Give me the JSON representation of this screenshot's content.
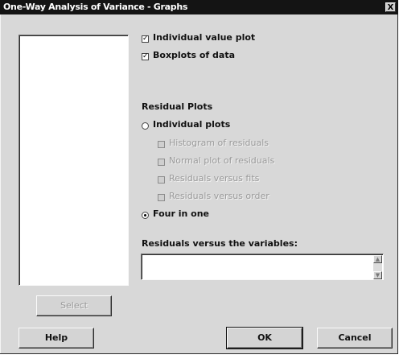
{
  "window": {
    "title": "One-Way Analysis of Variance - Graphs",
    "close_glyph": "X"
  },
  "graphs": {
    "individual_value_plot": {
      "label": "Individual value plot",
      "checked": true
    },
    "boxplots": {
      "label": "Boxplots of data",
      "checked": true
    }
  },
  "residual_plots": {
    "heading": "Residual Plots",
    "individual_plots": {
      "label": "Individual plots",
      "selected": false
    },
    "options": [
      {
        "label": "Histogram of residuals",
        "checked": false
      },
      {
        "label": "Normal plot of residuals",
        "checked": false
      },
      {
        "label": "Residuals versus fits",
        "checked": false
      },
      {
        "label": "Residuals versus order",
        "checked": false
      }
    ],
    "four_in_one": {
      "label": "Four in one",
      "selected": true
    }
  },
  "residuals_vs_vars": {
    "label": "Residuals versus the variables:",
    "value": ""
  },
  "buttons": {
    "select": "Select",
    "help": "Help",
    "ok": "OK",
    "cancel": "Cancel"
  },
  "icons": {
    "check_mark": "✓",
    "scroll_up": "▲",
    "scroll_down": "▼"
  }
}
